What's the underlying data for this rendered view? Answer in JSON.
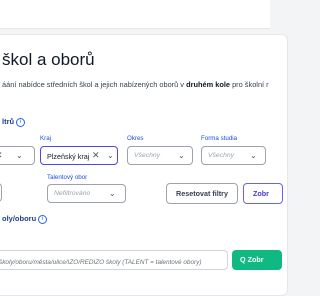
{
  "page": {
    "title": "škol a oborů",
    "description_pre": "áání nabídce středních škol a jejich nabízených oborů v ",
    "description_bold": "druhém kole",
    "description_post": " pro školní r"
  },
  "filters": {
    "heading": "ltrů",
    "kraj": {
      "label": "Kraj",
      "value": "Plzeňský kraj"
    },
    "okres": {
      "label": "Okres",
      "placeholder": "Všechny"
    },
    "forma": {
      "label": "Forma studia",
      "placeholder": "Všechny"
    },
    "obor": {
      "label": "Talentový obor",
      "placeholder": "Nefiltrováno"
    },
    "reset_label": "Resetovat filtry",
    "show_label": "Zobr"
  },
  "search": {
    "heading": "oly/oboru",
    "placeholder": "školy/oboru/města/ulice/IZO/REDIZO školy (TALENT = talentové obory)",
    "button_label": "Q Zobr"
  },
  "colors": {
    "accent": "#4f46e5",
    "label": "#1d4ed8",
    "success": "#10b981"
  }
}
